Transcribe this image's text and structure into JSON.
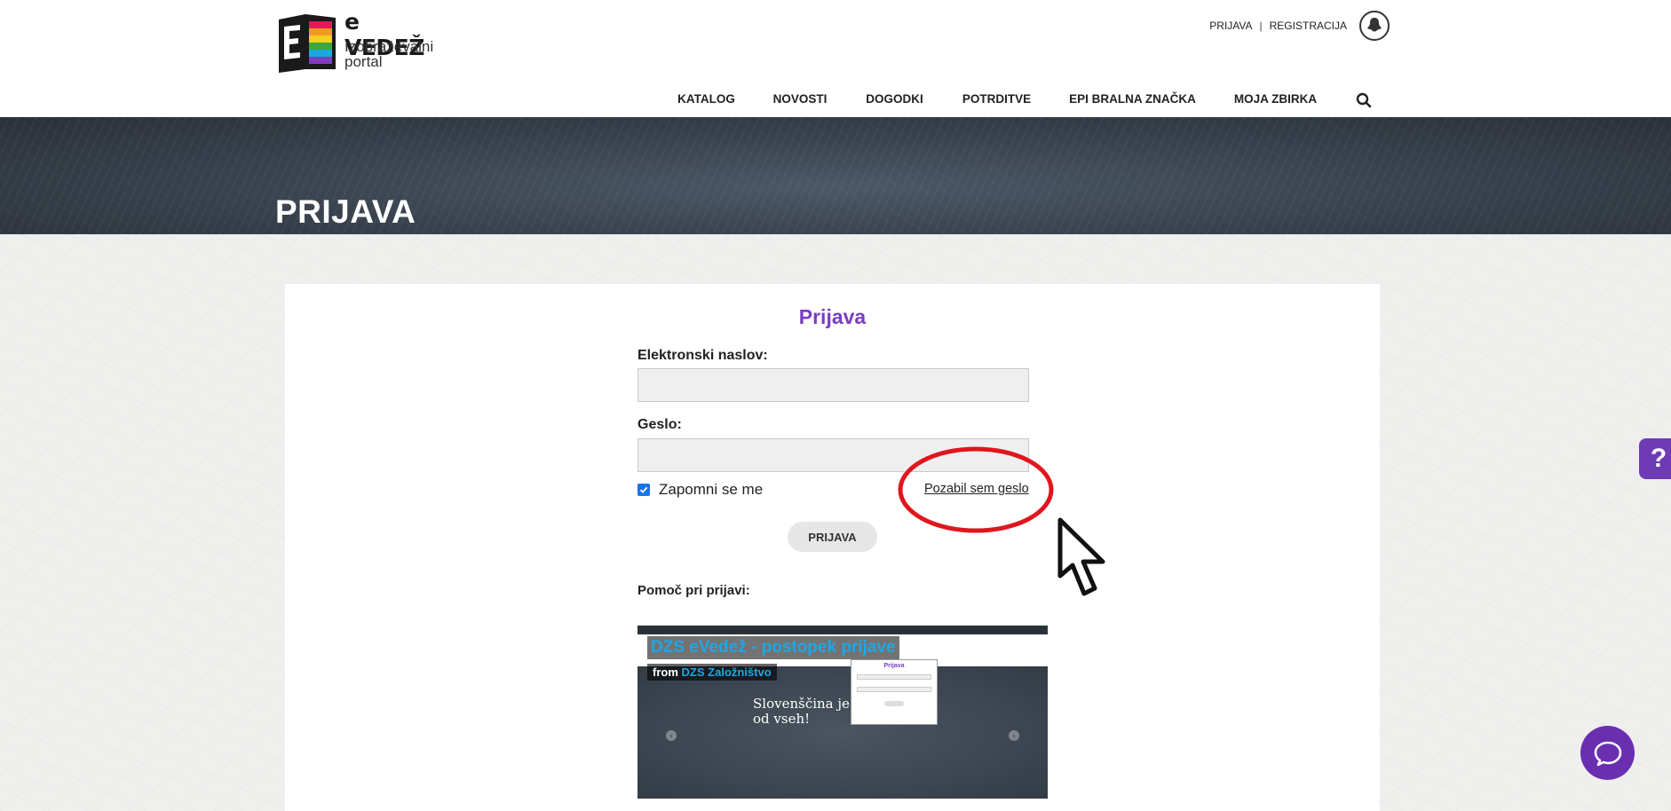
{
  "brand": {
    "name": "e VEDEŽ",
    "subtitle": "Izobraževalni portal"
  },
  "account": {
    "login": "PRIJAVA",
    "separator": "|",
    "register": "REGISTRACIJA"
  },
  "nav": [
    {
      "label": "KATALOG",
      "color": "#e6185c"
    },
    {
      "label": "NOVOSTI",
      "color": "#f29a1f"
    },
    {
      "label": "DOGODKI",
      "color": "#3aa842"
    },
    {
      "label": "POTRDITVE",
      "color": "#1fa6e0"
    },
    {
      "label": "EPI BRALNA ZNAČKA",
      "color": "#1b6fb8"
    },
    {
      "label": "MOJA ZBIRKA",
      "color": "#7b3fc0"
    },
    {
      "label": "",
      "color": "#d9d9d9"
    }
  ],
  "hero": {
    "title": "PRIJAVA"
  },
  "form": {
    "title": "Prijava",
    "email_label": "Elektronski naslov:",
    "email_value": "",
    "password_label": "Geslo:",
    "password_value": "",
    "remember_label": "Zapomni se me",
    "remember_checked": true,
    "forgot_link": "Pozabil sem geslo",
    "submit_label": "PRIJAVA",
    "help_label": "Pomoč pri prijavi:"
  },
  "video": {
    "title": "DZS eVedež - postopek prijave",
    "from_label": "from",
    "vendor": "DZS Založništvo",
    "slide_text_line1": "Slovenščina je",
    "slide_text_line2": "od vseh!",
    "popup_title": "Prijava"
  },
  "side_help": {
    "label": "?"
  },
  "colors": {
    "accent_purple": "#7a3cc0",
    "annotation_red": "#e0161e"
  }
}
